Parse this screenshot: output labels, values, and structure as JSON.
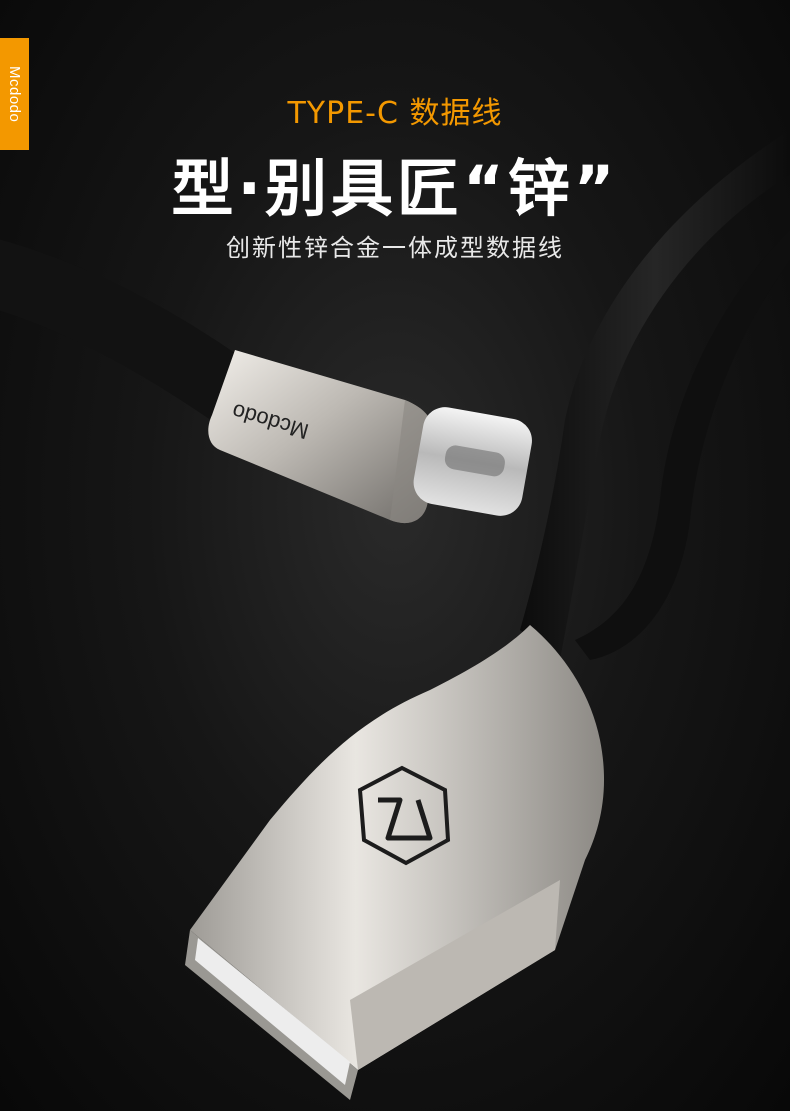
{
  "brand": {
    "logo_text": "Mcdodo"
  },
  "heading": {
    "headline": "TYPE-C 数据线",
    "title": "型·别具匠“锌”",
    "subtitle": "创新性锌合金一体成型数据线"
  },
  "colors": {
    "accent": "#f39800",
    "background": "#111111",
    "cable": "#141414",
    "metal": "#c9c6c1"
  },
  "icons": {
    "usb_logo": "hexagon-z-logo-icon"
  }
}
